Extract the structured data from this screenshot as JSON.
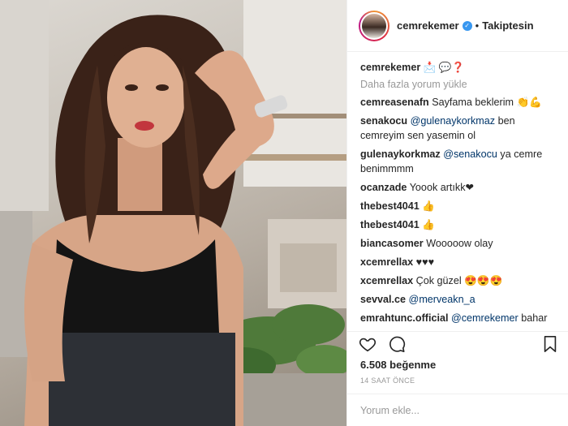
{
  "post": {
    "username": "cemrekemer",
    "verified_icon": "verified-badge-icon",
    "separator": "•",
    "follow_label": "Takiptesin",
    "load_more": "Daha fazla yorum yükle",
    "likes": "6.508 beğenme",
    "time": "14 SAAT ÖNCE",
    "comment_placeholder": "Yorum ekle..."
  },
  "caption": {
    "user": "cemrekemer",
    "text": "📩 💬❓"
  },
  "comments": [
    {
      "user": "cemreasenafn",
      "text": "Sayfama beklerim 👏💪"
    },
    {
      "user": "senakocu",
      "mention": "@gulenaykorkmaz",
      "text": "ben cemreyim sen yasemin ol"
    },
    {
      "user": "gulenaykorkmaz",
      "mention": "@senakocu",
      "text": "ya cemre benimmmm"
    },
    {
      "user": "ocanzade",
      "text": "Yoook artıkk❤"
    },
    {
      "user": "thebest4041",
      "text": "👍"
    },
    {
      "user": "thebest4041",
      "text": "👍"
    },
    {
      "user": "biancasomer",
      "text": "Wooooow olay"
    },
    {
      "user": "xcemrellax",
      "text": "♥♥♥"
    },
    {
      "user": "xcemrellax",
      "text": "Çok güzel 😍😍😍"
    },
    {
      "user": "sevval.ce",
      "mention": "@merveakn_a",
      "text": ""
    },
    {
      "user": "emrahtunc.official",
      "mention": "@cemrekemer",
      "text": "bahar geldi gözlerim yeşerdi"
    }
  ],
  "icons": {
    "like": "heart-icon",
    "comment": "comment-icon",
    "save": "bookmark-icon"
  },
  "colors": {
    "link": "#003569",
    "verified": "#3897f0",
    "muted": "#999999",
    "text": "#262626"
  }
}
